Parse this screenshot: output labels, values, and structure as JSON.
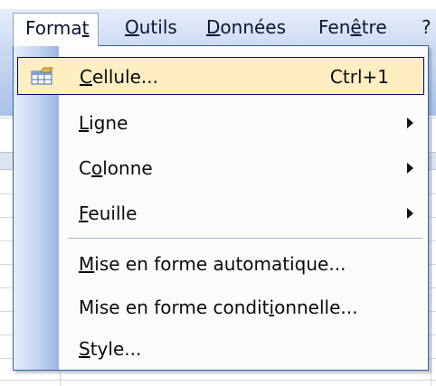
{
  "menubar": {
    "items": [
      {
        "label": "Format",
        "mnemonic_index": 5,
        "active": true
      },
      {
        "label": "Outils",
        "mnemonic_index": 0
      },
      {
        "label": "Données",
        "mnemonic_index": 0
      },
      {
        "label": "Fenêtre",
        "mnemonic_index": 3
      },
      {
        "label": "?",
        "mnemonic_index": -1
      }
    ]
  },
  "format_menu": {
    "items": [
      {
        "label": "Cellule...",
        "mnemonic_index": 0,
        "shortcut": "Ctrl+1",
        "icon": "format-cells-icon",
        "highlighted": true,
        "submenu": false
      },
      {
        "label": "Ligne",
        "mnemonic_index": 0,
        "shortcut": "",
        "submenu": true
      },
      {
        "label": "Colonne",
        "mnemonic_index": 1,
        "shortcut": "",
        "submenu": true
      },
      {
        "label": "Feuille",
        "mnemonic_index": 0,
        "shortcut": "",
        "submenu": true
      },
      {
        "label": "Mise en forme automatique...",
        "mnemonic_index": 0,
        "shortcut": "",
        "submenu": false
      },
      {
        "label": "Mise en forme conditionnelle...",
        "mnemonic_index": 20,
        "shortcut": "",
        "submenu": false
      },
      {
        "label": "Style...",
        "mnemonic_index": 0,
        "shortcut": "",
        "submenu": false
      }
    ]
  },
  "colors": {
    "menu_border": "#2f5fa8",
    "highlight_bg": "#ffeec2",
    "highlight_border": "#000080",
    "menubar_bg": "#d5e1f5"
  }
}
